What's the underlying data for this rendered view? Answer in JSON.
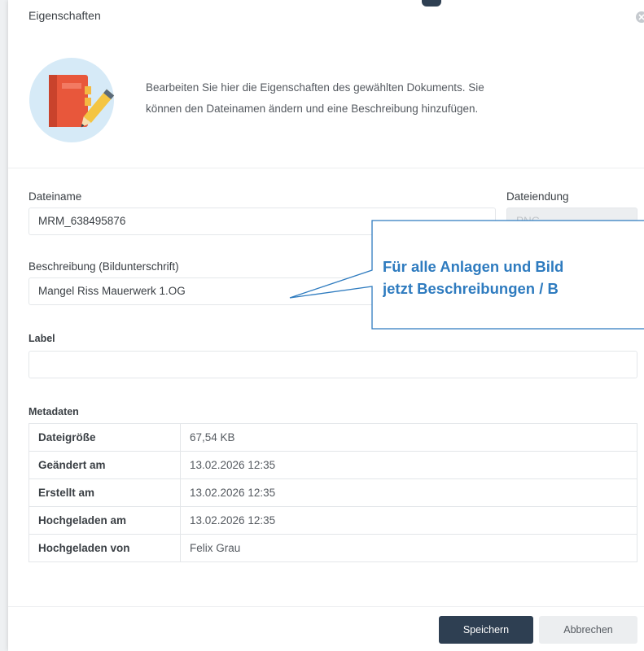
{
  "dialog": {
    "title": "Eigenschaften",
    "close_icon": "close-circle-icon"
  },
  "intro": {
    "icon": "notebook-pencil-icon",
    "text_line1": "Bearbeiten Sie hier die Eigenschaften des gewählten Dokuments. Sie",
    "text_line2": "können den Dateinamen ändern und eine Beschreibung hinzufügen."
  },
  "form": {
    "filename_label": "Dateiname",
    "filename_value": "MRM_638495876",
    "extension_label": "Dateiendung",
    "extension_value": "PNG",
    "description_label": "Beschreibung (Bildunterschrift)",
    "description_value": "Mangel Riss Mauerwerk 1.OG",
    "label_label": "Label",
    "label_value": ""
  },
  "metadata": {
    "heading": "Metadaten",
    "rows": [
      {
        "key": "Dateigröße",
        "value": "67,54 KB"
      },
      {
        "key": "Geändert am",
        "value": "13.02.2026 12:35"
      },
      {
        "key": "Erstellt am",
        "value": "13.02.2026 12:35"
      },
      {
        "key": "Hochgeladen am",
        "value": "13.02.2026 12:35"
      },
      {
        "key": "Hochgeladen von",
        "value": "Felix Grau"
      }
    ]
  },
  "footer": {
    "save_label": "Speichern",
    "cancel_label": "Abbrechen"
  },
  "callout": {
    "line1": "Für alle Anlagen und Bild",
    "line2": "jetzt Beschreibungen / B"
  },
  "colors": {
    "accent": "#2e3f52",
    "callout": "#2e7bbf"
  }
}
